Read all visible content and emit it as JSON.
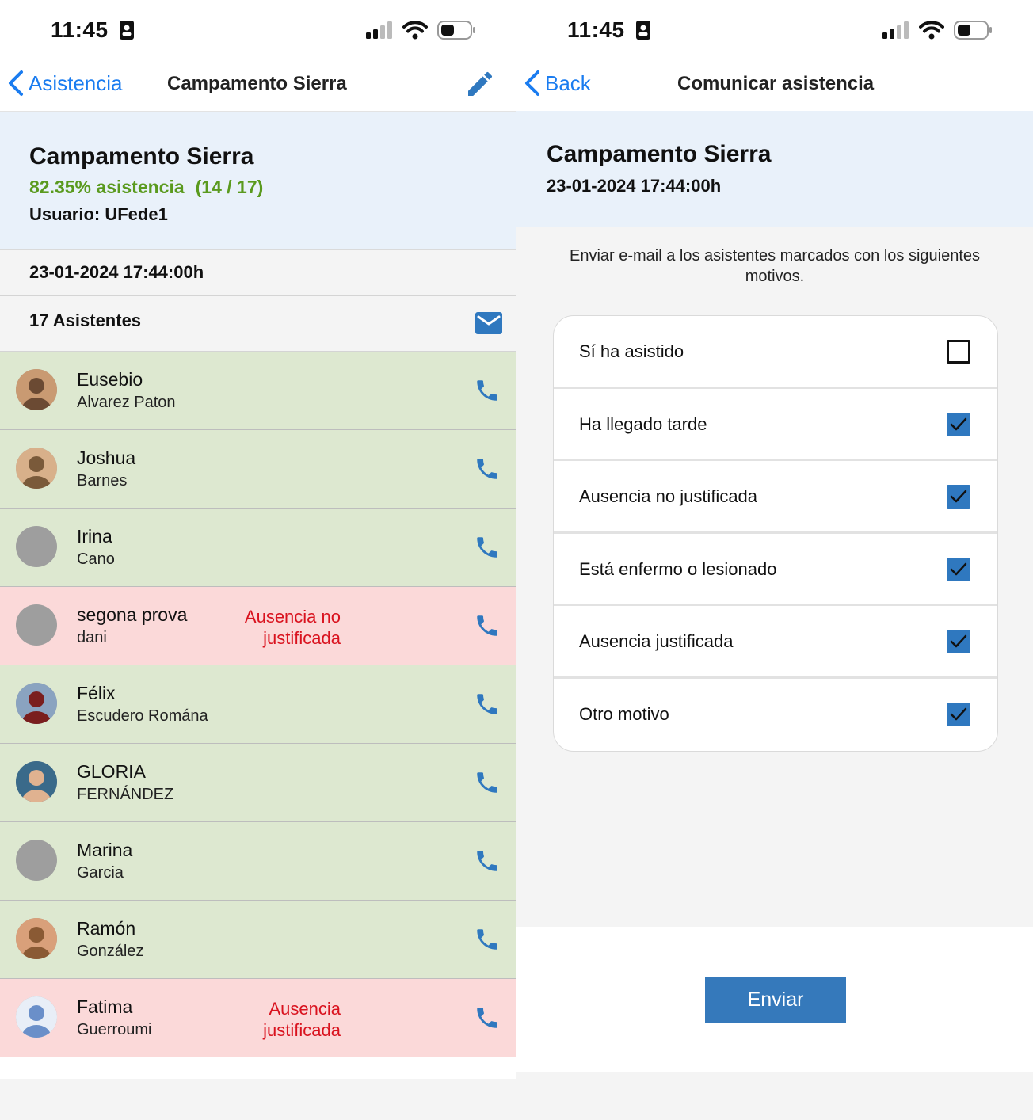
{
  "left": {
    "status_bar": {
      "time": "11:45"
    },
    "nav": {
      "back_label": "Asistencia",
      "title": "Campamento Sierra"
    },
    "header": {
      "event_name": "Campamento Sierra",
      "attendance_pct": "82.35% asistencia",
      "attendance_count": "(14 / 17)",
      "user": "Usuario: UFede1"
    },
    "date": "23-01-2024 17:44:00h",
    "attendee_count": "17 Asistentes",
    "attendees": [
      {
        "first": "Eusebio",
        "last": "Alvarez Paton",
        "note": "",
        "status": "present",
        "avatar": "photo"
      },
      {
        "first": "Joshua",
        "last": "Barnes",
        "note": "",
        "status": "present",
        "avatar": "photo"
      },
      {
        "first": "Irina",
        "last": "Cano",
        "note": "",
        "status": "present",
        "avatar": "placeholder"
      },
      {
        "first": "segona prova",
        "last": "dani",
        "note": "Ausencia no justificada",
        "status": "absent",
        "avatar": "placeholder"
      },
      {
        "first": "Félix",
        "last": "Escudero Romána",
        "note": "",
        "status": "present",
        "avatar": "photo"
      },
      {
        "first": "GLORIA",
        "last": "FERNÁNDEZ",
        "note": "",
        "status": "present",
        "avatar": "photo"
      },
      {
        "first": "Marina",
        "last": "Garcia",
        "note": "",
        "status": "present",
        "avatar": "placeholder"
      },
      {
        "first": "Ramón",
        "last": "González",
        "note": "",
        "status": "present",
        "avatar": "photo"
      },
      {
        "first": "Fatima",
        "last": "Guerroumi",
        "note": "Ausencia justificada",
        "status": "absent",
        "avatar": "photo"
      }
    ]
  },
  "right": {
    "status_bar": {
      "time": "11:45"
    },
    "nav": {
      "back_label": "Back",
      "title": "Comunicar asistencia"
    },
    "header": {
      "event_name": "Campamento Sierra",
      "date": "23-01-2024 17:44:00h"
    },
    "instruction": "Enviar e-mail a los asistentes marcados con los siguientes motivos.",
    "reasons": [
      {
        "label": "Sí ha asistido",
        "checked": false
      },
      {
        "label": "Ha llegado tarde",
        "checked": true
      },
      {
        "label": "Ausencia no justificada",
        "checked": true
      },
      {
        "label": "Está enfermo o lesionado",
        "checked": true
      },
      {
        "label": "Ausencia justificada",
        "checked": true
      },
      {
        "label": "Otro motivo",
        "checked": true
      }
    ],
    "send_label": "Enviar"
  },
  "colors": {
    "ios_blue": "#1a7cf0",
    "attendance_green": "#5a9a1e",
    "present_row": "#dde8d0",
    "absent_row": "#fbd9d9",
    "absence_text": "#d9121e",
    "header_bg": "#e9f1fa",
    "send_button": "#3579bb",
    "checkbox_blue": "#2f78bf"
  },
  "icons": {
    "back": "chevron-left-icon",
    "edit": "pencil-icon",
    "mail": "envelope-icon",
    "call": "phone-icon",
    "signal": "cellular-signal-icon",
    "wifi": "wifi-icon",
    "battery": "battery-icon"
  }
}
